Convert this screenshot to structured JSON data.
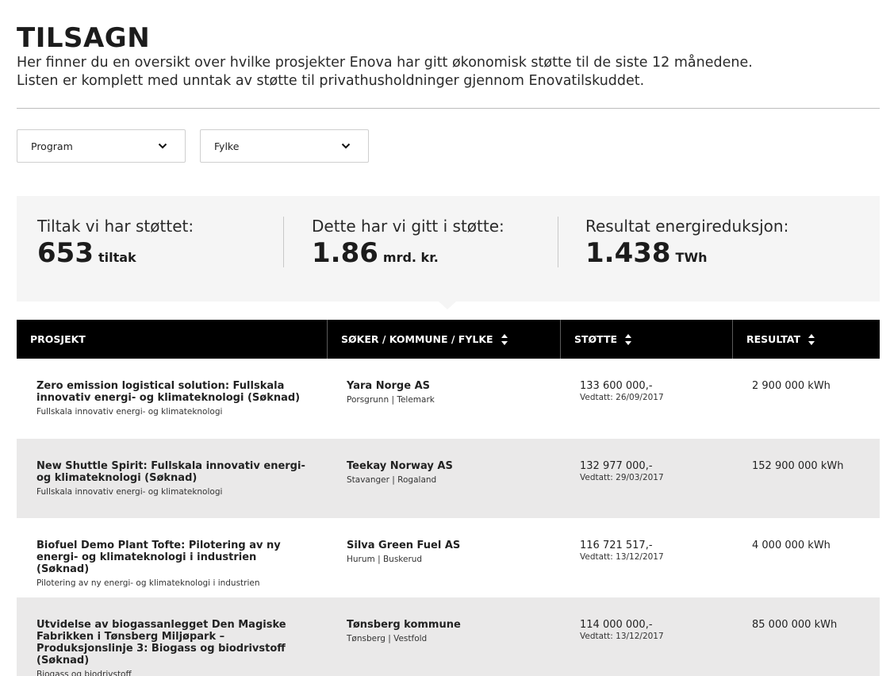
{
  "header": {
    "title": "TILSAGN",
    "intro_line1": "Her finner du en oversikt over hvilke prosjekter Enova har gitt økonomisk støtte til de siste 12 månedene.",
    "intro_line2": "Listen er komplett med unntak av støtte til privathusholdninger gjennom Enovatilskuddet."
  },
  "filters": {
    "program": {
      "label": "Program",
      "icon": "chevron-down-icon"
    },
    "fylke": {
      "label": "Fylke",
      "icon": "chevron-down-icon"
    }
  },
  "stats": [
    {
      "label": "Tiltak vi har støttet:",
      "value": "653",
      "unit": "tiltak"
    },
    {
      "label": "Dette har vi gitt i støtte:",
      "value": "1.86",
      "unit": "mrd. kr."
    },
    {
      "label": "Resultat energireduksjon:",
      "value": "1.438",
      "unit": "TWh"
    }
  ],
  "table": {
    "columns": [
      {
        "label": "PROSJEKT",
        "sortable": false
      },
      {
        "label": "SØKER / KOMMUNE / FYLKE",
        "sortable": true
      },
      {
        "label": "STØTTE",
        "sortable": true
      },
      {
        "label": "RESULTAT",
        "sortable": true
      }
    ],
    "rows": [
      {
        "project": "Zero emission logistical solution: Fullskala innovativ energi- og klimateknologi (Søknad)",
        "program": "Fullskala innovativ energi- og klimateknologi",
        "applicant": "Yara Norge AS",
        "location": "Porsgrunn | Telemark",
        "amount": "133 600 000,-",
        "date": "Vedtatt: 26/09/2017",
        "result": "2 900 000 kWh"
      },
      {
        "project": "New Shuttle Spirit: Fullskala innovativ energi- og klimateknologi (Søknad)",
        "program": "Fullskala innovativ energi- og klimateknologi",
        "applicant": "Teekay Norway AS",
        "location": "Stavanger | Rogaland",
        "amount": "132 977 000,-",
        "date": "Vedtatt: 29/03/2017",
        "result": "152 900 000 kWh"
      },
      {
        "project": "Biofuel Demo Plant Tofte: Pilotering av ny energi- og klimateknologi i industrien (Søknad)",
        "program": "Pilotering av ny energi- og klimateknologi i industrien",
        "applicant": "Silva Green Fuel AS",
        "location": "Hurum | Buskerud",
        "amount": "116 721 517,-",
        "date": "Vedtatt: 13/12/2017",
        "result": "4 000 000 kWh"
      },
      {
        "project": "Utvidelse av biogassanlegget Den Magiske Fabrikken i Tønsberg Miljøpark – Produksjonslinje 3: Biogass og biodrivstoff (Søknad)",
        "program": "Biogass og biodrivstoff",
        "applicant": "Tønsberg kommune",
        "location": "Tønsberg | Vestfold",
        "amount": "114 000 000,-",
        "date": "Vedtatt: 13/12/2017",
        "result": "85 000 000 kWh"
      }
    ]
  }
}
